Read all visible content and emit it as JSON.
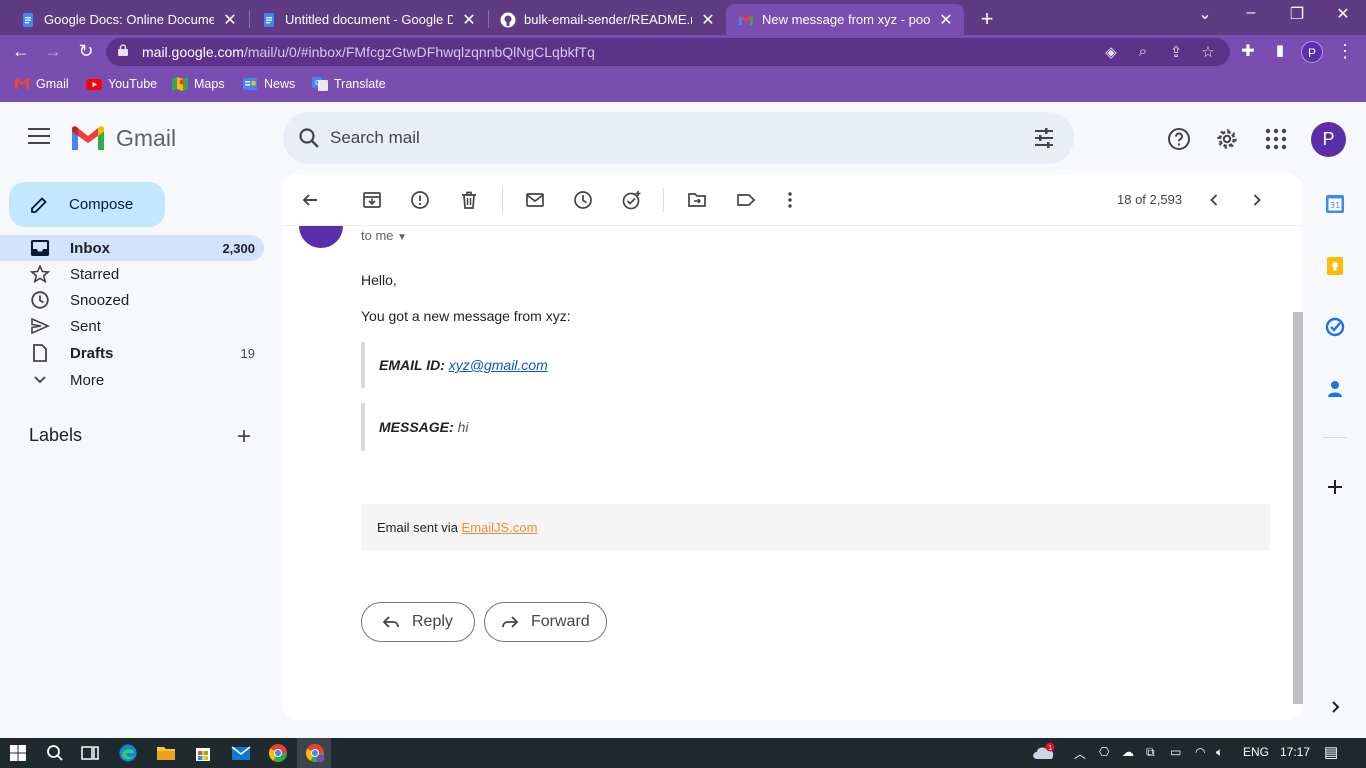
{
  "browser": {
    "tabs": [
      {
        "title": "Google Docs: Online Document E",
        "icon": "google-docs-icon"
      },
      {
        "title": "Untitled document - Google Doc",
        "icon": "google-docs-icon"
      },
      {
        "title": "bulk-email-sender/README.md a",
        "icon": "github-icon"
      },
      {
        "title": "New message from xyz - poojash",
        "icon": "gmail-icon",
        "active": true
      }
    ],
    "url_host": "mail.google.com",
    "url_path": "/mail/u/0/#inbox/FMfcgzGtwDFhwqlzqnnbQlNgCLqbkfTq",
    "profile_initial": "P",
    "bookmarks": [
      "Gmail",
      "YouTube",
      "Maps",
      "News",
      "Translate"
    ]
  },
  "gmail": {
    "logo_text": "Gmail",
    "search_placeholder": "Search mail",
    "avatar_initial": "P",
    "compose_label": "Compose",
    "nav": [
      {
        "label": "Inbox",
        "count": "2,300"
      },
      {
        "label": "Starred",
        "count": ""
      },
      {
        "label": "Snoozed",
        "count": ""
      },
      {
        "label": "Sent",
        "count": ""
      },
      {
        "label": "Drafts",
        "count": "19"
      },
      {
        "label": "More",
        "count": ""
      }
    ],
    "labels_heading": "Labels",
    "pager": "18 of 2,593",
    "message": {
      "to_me": "to me",
      "greeting": "Hello,",
      "intro": "You got a new message from xyz:",
      "email_label": "EMAIL ID:",
      "email_value": "xyz@gmail.com",
      "message_label": "MESSAGE:",
      "message_value": "hi",
      "footer_prefix": "Email sent via",
      "footer_link": "EmailJS.com"
    },
    "reply_label": "Reply",
    "forward_label": "Forward"
  },
  "taskbar": {
    "language": "ENG",
    "time": "17:17",
    "notification_count": "1"
  },
  "colors": {
    "chrome_dark": "#5f3b84",
    "chrome_light": "#7a4db0",
    "gmail_bg": "#f6f8fc",
    "compose_bg": "#c2e7ff",
    "inbox_active_bg": "#d3e3fd",
    "avatar": "#5b2eaa",
    "emailjs_link": "#f28b3c"
  }
}
